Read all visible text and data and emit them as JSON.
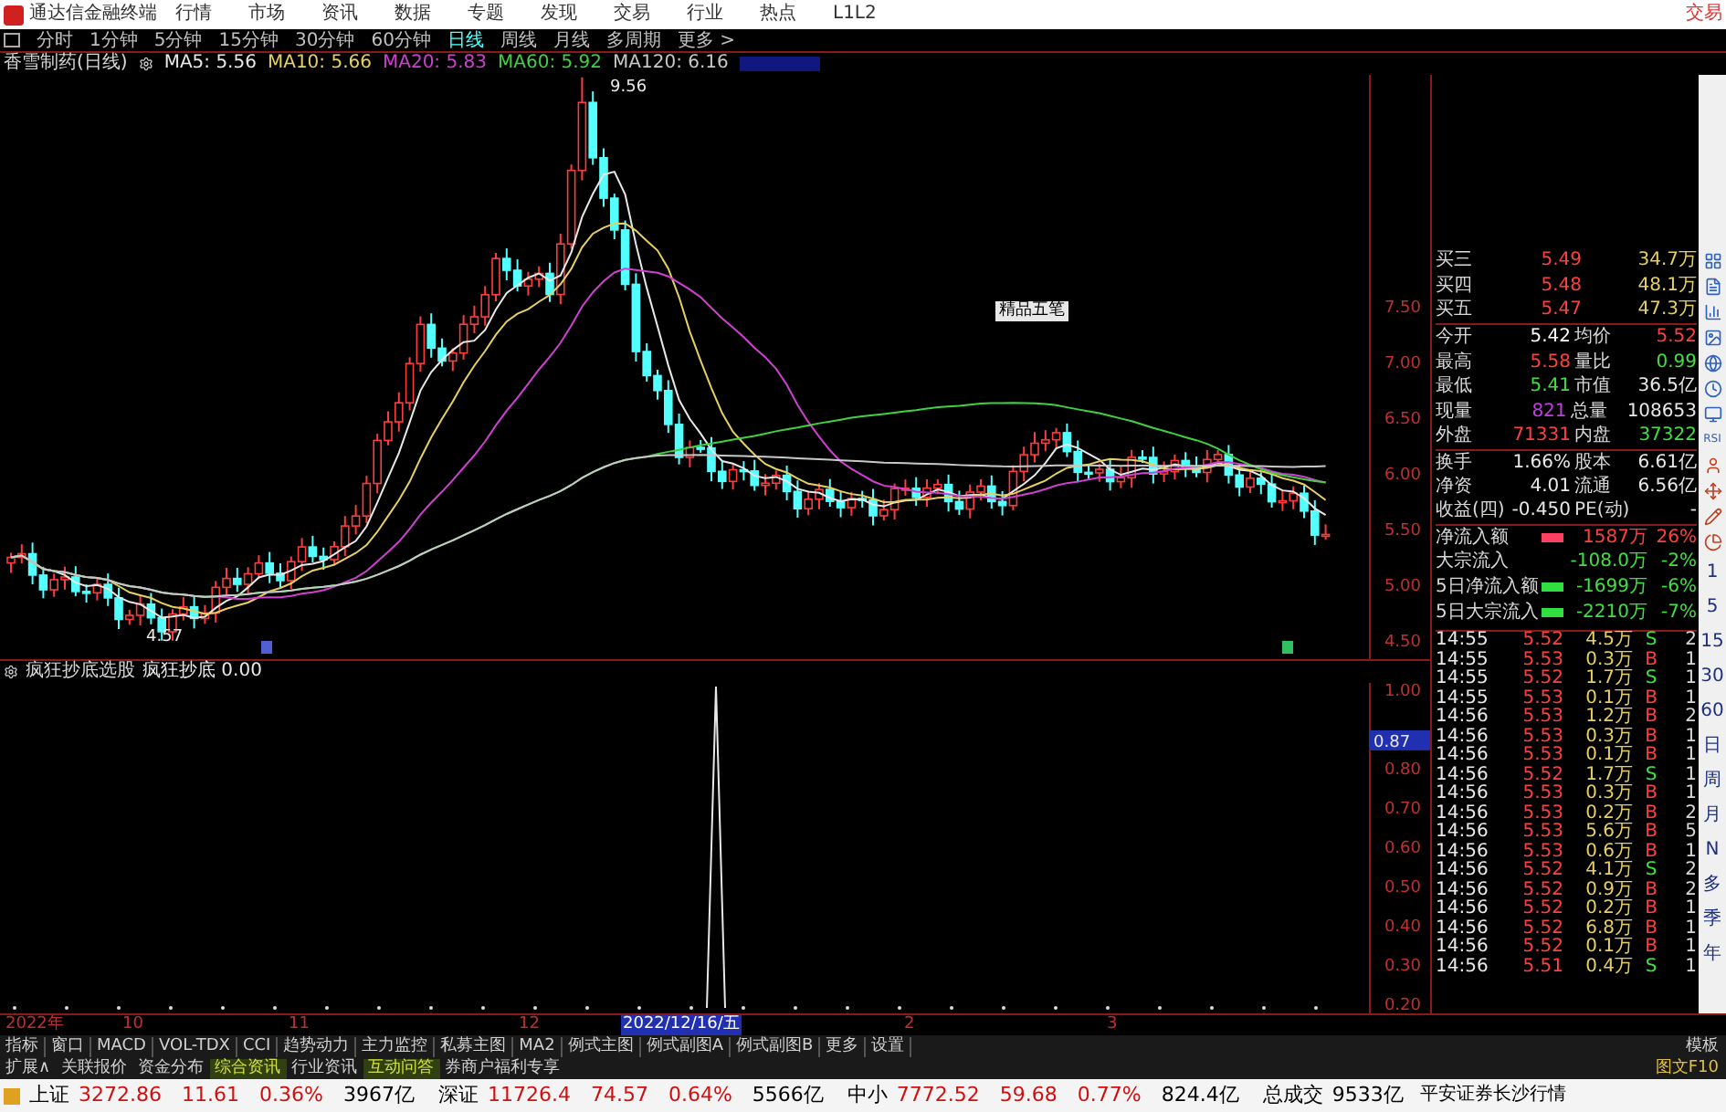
{
  "menu_bar": {
    "title": "通达信金融终端",
    "items": [
      "行情",
      "市场",
      "资讯",
      "数据",
      "专题",
      "发现",
      "交易",
      "行业",
      "热点",
      "L1L2"
    ],
    "trade": "交易"
  },
  "period_bar": {
    "items": [
      {
        "label": "分时",
        "selected": false
      },
      {
        "label": "1分钟",
        "selected": false
      },
      {
        "label": "5分钟",
        "selected": false
      },
      {
        "label": "15分钟",
        "selected": false
      },
      {
        "label": "30分钟",
        "selected": false
      },
      {
        "label": "60分钟",
        "selected": false
      },
      {
        "label": "日线",
        "selected": true
      },
      {
        "label": "周线",
        "selected": false
      },
      {
        "label": "月线",
        "selected": false
      },
      {
        "label": "多周期",
        "selected": false
      },
      {
        "label": "更多 >",
        "selected": false
      }
    ]
  },
  "ma_legend": {
    "stock": "香雪制药(日线)",
    "items": [
      {
        "label": "MA5: 5.56",
        "color": "#e8e8e8"
      },
      {
        "label": "MA10: 5.66",
        "color": "#e8d060"
      },
      {
        "label": "MA20: 5.83",
        "color": "#d040d0"
      },
      {
        "label": "MA60: 5.92",
        "color": "#40d040"
      },
      {
        "label": "MA120: 6.16",
        "color": "#c8c8c8"
      }
    ]
  },
  "main_chart": {
    "price_ticks": [
      "7.50",
      "7.00",
      "6.50",
      "6.00",
      "5.50",
      "5.00",
      "4.50"
    ],
    "high_label": "9.56",
    "low_label": "4.57",
    "popup": "精品五笔"
  },
  "indicator": {
    "name": "疯狂抄底选股",
    "line_label": "疯狂抄底 0.00",
    "ticks": [
      "1.00",
      "0.80",
      "0.70",
      "0.60",
      "0.50",
      "0.40",
      "0.30",
      "0.20"
    ],
    "cursor_value": "0.87"
  },
  "date_axis": [
    {
      "label": "2022年",
      "selected": false
    },
    {
      "label": "10",
      "selected": false
    },
    {
      "label": "11",
      "selected": false
    },
    {
      "label": "12",
      "selected": false
    },
    {
      "label": "2022/12/16/五",
      "selected": true
    },
    {
      "label": "2",
      "selected": false
    },
    {
      "label": "3",
      "selected": false
    }
  ],
  "indicator_tabs": {
    "items": [
      "指标",
      "窗口",
      "MACD",
      "VOL-TDX",
      "CCI",
      "趋势动力",
      "主力监控",
      "私募主图",
      "MA2",
      "例式主图",
      "例式副图A",
      "例式副图B",
      "更多",
      "设置"
    ],
    "right": "模板"
  },
  "info_tabs": {
    "items": [
      {
        "label": "扩展∧",
        "highlighted": false
      },
      {
        "label": "关联报价",
        "highlighted": false
      },
      {
        "label": "资金分布",
        "highlighted": false
      },
      {
        "label": "综合资讯",
        "highlighted": true
      },
      {
        "label": "行业资讯",
        "highlighted": false
      },
      {
        "label": "互动问答",
        "highlighted": true
      },
      {
        "label": "券商户福利专享",
        "highlighted": false
      }
    ],
    "right": "图文F10"
  },
  "order_book": [
    {
      "label": "买三",
      "price": "5.49",
      "volume": "34.7万"
    },
    {
      "label": "买四",
      "price": "5.48",
      "volume": "48.1万"
    },
    {
      "label": "买五",
      "price": "5.47",
      "volume": "47.3万"
    }
  ],
  "stats": [
    {
      "cells": [
        {
          "label": "今开",
          "value": "5.42",
          "kind": "open"
        },
        {
          "label": "均价",
          "value": "5.52",
          "kind": "rise"
        }
      ]
    },
    {
      "cells": [
        {
          "label": "最高",
          "value": "5.58",
          "kind": "rise"
        },
        {
          "label": "量比",
          "value": "0.99",
          "kind": "fall"
        }
      ]
    },
    {
      "cells": [
        {
          "label": "最低",
          "value": "5.41",
          "kind": "fall"
        },
        {
          "label": "市值",
          "value": "36.5亿",
          "kind": "flat"
        }
      ]
    },
    {
      "cells": [
        {
          "label": "现量",
          "value": "821",
          "kind": "current"
        },
        {
          "label": "总量",
          "value": "108653",
          "kind": "flat"
        }
      ]
    },
    {
      "cells": [
        {
          "label": "外盘",
          "value": "71331",
          "kind": "rise"
        },
        {
          "label": "内盘",
          "value": "37322",
          "kind": "fall"
        }
      ]
    },
    {
      "cells": [
        {
          "label": "换手",
          "value": "1.66%",
          "kind": "flat"
        },
        {
          "label": "股本",
          "value": "6.61亿",
          "kind": "flat"
        }
      ]
    },
    {
      "cells": [
        {
          "label": "净资",
          "value": "4.01",
          "kind": "flat"
        },
        {
          "label": "流通",
          "value": "6.56亿",
          "kind": "flat"
        }
      ]
    },
    {
      "cells": [
        {
          "label": "收益(四)",
          "value": "-0.450",
          "kind": "flat"
        },
        {
          "label": "PE(动)",
          "value": "-",
          "kind": "flat"
        }
      ]
    }
  ],
  "fund_flows": [
    {
      "label": "净流入额",
      "kind": "in",
      "amount": "1587万",
      "pct": "26%"
    },
    {
      "label": "大宗流入",
      "kind": "none",
      "amount": "-108.0万",
      "pct": "-2%"
    },
    {
      "label": "5日净流入额",
      "kind": "out",
      "amount": "-1699万",
      "pct": "-6%"
    },
    {
      "label": "5日大宗流入",
      "kind": "out",
      "amount": "-2210万",
      "pct": "-7%"
    }
  ],
  "ticks": [
    {
      "time": "14:55",
      "price": "5.52",
      "volume": "4.5万",
      "side": "S",
      "kind": "sell",
      "count": "2"
    },
    {
      "time": "14:55",
      "price": "5.53",
      "volume": "0.3万",
      "side": "B",
      "kind": "buy",
      "count": "1"
    },
    {
      "time": "14:55",
      "price": "5.52",
      "volume": "1.7万",
      "side": "S",
      "kind": "sell",
      "count": "1"
    },
    {
      "time": "14:55",
      "price": "5.53",
      "volume": "0.1万",
      "side": "B",
      "kind": "buy",
      "count": "1"
    },
    {
      "time": "14:56",
      "price": "5.53",
      "volume": "1.2万",
      "side": "B",
      "kind": "buy",
      "count": "2"
    },
    {
      "time": "14:56",
      "price": "5.53",
      "volume": "0.3万",
      "side": "B",
      "kind": "buy",
      "count": "1"
    },
    {
      "time": "14:56",
      "price": "5.53",
      "volume": "0.1万",
      "side": "B",
      "kind": "buy",
      "count": "1"
    },
    {
      "time": "14:56",
      "price": "5.52",
      "volume": "1.7万",
      "side": "S",
      "kind": "sell",
      "count": "1"
    },
    {
      "time": "14:56",
      "price": "5.53",
      "volume": "0.3万",
      "side": "B",
      "kind": "buy",
      "count": "1"
    },
    {
      "time": "14:56",
      "price": "5.53",
      "volume": "0.2万",
      "side": "B",
      "kind": "buy",
      "count": "2"
    },
    {
      "time": "14:56",
      "price": "5.53",
      "volume": "5.6万",
      "side": "B",
      "kind": "buy",
      "count": "5"
    },
    {
      "time": "14:56",
      "price": "5.53",
      "volume": "0.6万",
      "side": "B",
      "kind": "buy",
      "count": "1"
    },
    {
      "time": "14:56",
      "price": "5.52",
      "volume": "4.1万",
      "side": "S",
      "kind": "sell",
      "count": "2"
    },
    {
      "time": "14:56",
      "price": "5.52",
      "volume": "0.9万",
      "side": "B",
      "kind": "buy",
      "count": "2"
    },
    {
      "time": "14:56",
      "price": "5.52",
      "volume": "0.2万",
      "side": "B",
      "kind": "buy",
      "count": "1"
    },
    {
      "time": "14:56",
      "price": "5.52",
      "volume": "6.8万",
      "side": "B",
      "kind": "buy",
      "count": "1"
    },
    {
      "time": "14:56",
      "price": "5.52",
      "volume": "0.1万",
      "side": "B",
      "kind": "buy",
      "count": "1"
    },
    {
      "time": "14:56",
      "price": "5.51",
      "volume": "0.4万",
      "side": "S",
      "kind": "sell",
      "count": "1"
    }
  ],
  "toolbar": {
    "rsi": "RSI",
    "periods": [
      "1",
      "5",
      "15",
      "30",
      "60",
      "日",
      "周",
      "月",
      "N",
      "多",
      "季",
      "年"
    ]
  },
  "status_bar": {
    "indices": [
      {
        "name": "上证",
        "value": "3272.86",
        "change": "11.61",
        "pct": "0.36%",
        "amount": "3967亿"
      },
      {
        "name": "深证",
        "value": "11726.4",
        "change": "74.57",
        "pct": "0.64%",
        "amount": "5566亿"
      },
      {
        "name": "中小",
        "value": "7772.52",
        "change": "59.68",
        "pct": "0.77%",
        "amount": "824.4亿"
      }
    ],
    "total_label": "总成交",
    "total": "9533亿",
    "broker": "平安证券长沙行情"
  }
}
